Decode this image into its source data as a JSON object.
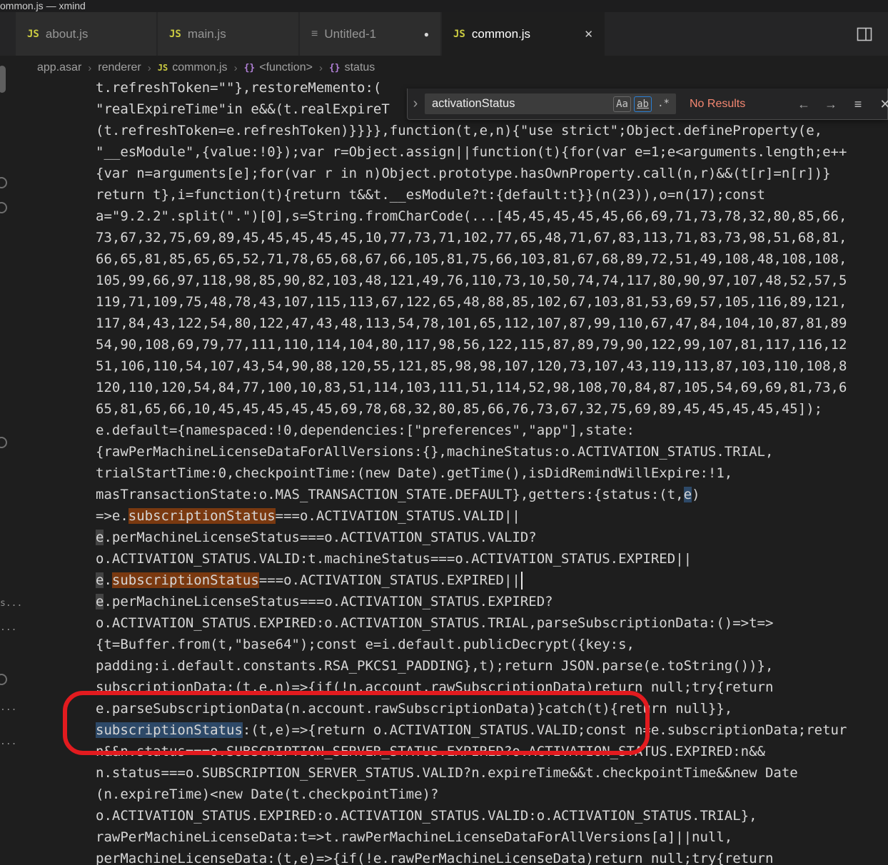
{
  "window": {
    "title": "ommon.js — xmind"
  },
  "icons": {
    "js": "JS",
    "file": "≡",
    "dirty": "●",
    "close": "✕",
    "chevron": "›",
    "symbol": "{}",
    "prev": "←",
    "next": "→",
    "selection": "≡"
  },
  "tabs": [
    {
      "label": "about.js",
      "icon": "js",
      "active": false,
      "dirty": false,
      "closable": false
    },
    {
      "label": "main.js",
      "icon": "js",
      "active": false,
      "dirty": false,
      "closable": false
    },
    {
      "label": "Untitled-1",
      "icon": "file",
      "active": false,
      "dirty": true,
      "closable": false
    },
    {
      "label": "common.js",
      "icon": "js",
      "active": true,
      "dirty": false,
      "closable": true
    }
  ],
  "breadcrumbs": [
    {
      "label": "app.asar"
    },
    {
      "label": "renderer"
    },
    {
      "label": "common.js",
      "icon": "js"
    },
    {
      "label": "<function>",
      "icon": "symbol"
    },
    {
      "label": "status",
      "icon": "symbol"
    }
  ],
  "find": {
    "query": "activationStatus",
    "match_case_label": "Aa",
    "whole_word_label": "ab",
    "regex_label": ".*",
    "results_text": "No Results"
  },
  "colors": {
    "accent_blue": "#2a7fd4",
    "match_orange": "#ea5c00",
    "error_red": "#f48771",
    "annotation_red": "#e21b1f",
    "js_icon_yellow": "#cbcb41",
    "symbol_purple": "#b180d7"
  },
  "editor": {
    "gutter_fragments": [
      "s...",
      "...",
      "...",
      "..."
    ],
    "lines": [
      {
        "segs": [
          {
            "t": "t.refreshToken=\"\"},restoreMemento:("
          }
        ]
      },
      {
        "segs": [
          {
            "t": "\"realExpireTime\"in e&&(t.realExpireT"
          }
        ]
      },
      {
        "segs": [
          {
            "t": "(t.refreshToken=e.refreshToken)}}}},function(t,e,n){\"use strict\";Object.defineProperty(e,"
          }
        ]
      },
      {
        "segs": [
          {
            "t": "\"__esModule\",{value:!0});var r=Object.assign||function(t){for(var e=1;e<arguments.length;e++"
          }
        ]
      },
      {
        "segs": [
          {
            "t": "{var n=arguments[e];for(var r in n)Object.prototype.hasOwnProperty.call(n,r)&&(t[r]=n[r])}"
          }
        ]
      },
      {
        "segs": [
          {
            "t": "return t},i=function(t){return t&&t.__esModule?t:{default:t}}(n(23)),o=n(17);const"
          }
        ]
      },
      {
        "segs": [
          {
            "t": "a=\"9.2.2\".split(\".\")[0],s=String.fromCharCode(...[45,45,45,45,45,66,69,71,73,78,32,80,85,66,"
          }
        ]
      },
      {
        "segs": [
          {
            "t": "73,67,32,75,69,89,45,45,45,45,45,10,77,73,71,102,77,65,48,71,67,83,113,71,83,73,98,51,68,81,"
          }
        ]
      },
      {
        "segs": [
          {
            "t": "66,65,81,85,65,65,52,71,78,65,68,67,66,105,81,75,66,103,81,67,68,89,72,51,49,108,48,108,108,"
          }
        ]
      },
      {
        "segs": [
          {
            "t": "105,99,66,97,118,98,85,90,82,103,48,121,49,76,110,73,10,50,74,74,117,80,90,97,107,48,52,57,5"
          }
        ]
      },
      {
        "segs": [
          {
            "t": "119,71,109,75,48,78,43,107,115,113,67,122,65,48,88,85,102,67,103,81,53,69,57,105,116,89,121,"
          }
        ]
      },
      {
        "segs": [
          {
            "t": "117,84,43,122,54,80,122,47,43,48,113,54,78,101,65,112,107,87,99,110,67,47,84,104,10,87,81,89"
          }
        ]
      },
      {
        "segs": [
          {
            "t": "54,90,108,69,79,77,111,110,114,104,80,117,98,56,122,115,87,89,79,90,122,99,107,81,117,116,12"
          }
        ]
      },
      {
        "segs": [
          {
            "t": "51,106,110,54,107,43,54,90,88,120,55,121,85,98,98,107,120,73,107,43,119,113,87,103,110,108,8"
          }
        ]
      },
      {
        "segs": [
          {
            "t": "120,110,120,54,84,77,100,10,83,51,114,103,111,51,114,52,98,108,70,84,87,105,54,69,69,81,73,6"
          }
        ]
      },
      {
        "segs": [
          {
            "t": "65,81,65,66,10,45,45,45,45,45,69,78,68,32,80,85,66,76,73,67,32,75,69,89,45,45,45,45,45]);"
          }
        ]
      },
      {
        "segs": [
          {
            "t": "e.default={namespaced:!0,dependencies:[\"preferences\",\"app\"],state:"
          }
        ]
      },
      {
        "segs": [
          {
            "t": "{rawPerMachineLicenseDataForAllVersions:{},machineStatus:o.ACTIVATION_STATUS.TRIAL,"
          }
        ]
      },
      {
        "segs": [
          {
            "t": "trialStartTime:0,checkpointTime:(new Date).getTime(),isDidRemindWillExpire:!1,"
          }
        ]
      },
      {
        "segs": [
          {
            "t": "masTransactionState:o.MAS_TRANSACTION_STATE.DEFAULT},getters:{status:(t,"
          },
          {
            "t": "e",
            "h": "s"
          },
          {
            "t": ")"
          }
        ]
      },
      {
        "segs": [
          {
            "t": "=>e."
          },
          {
            "t": "subscriptionStatus",
            "h": "m"
          },
          {
            "t": "===o.ACTIVATION_STATUS.VALID||"
          }
        ]
      },
      {
        "segs": [
          {
            "t": "e",
            "h": "w"
          },
          {
            "t": ".perMachineLicenseStatus===o.ACTIVATION_STATUS.VALID?"
          }
        ]
      },
      {
        "segs": [
          {
            "t": "o.ACTIVATION_STATUS.VALID:t.machineStatus===o.ACTIVATION_STATUS.EXPIRED||"
          }
        ]
      },
      {
        "segs": [
          {
            "t": "e",
            "h": "w"
          },
          {
            "t": "."
          },
          {
            "t": "subscriptionStatus",
            "h": "m"
          },
          {
            "t": "===o.ACTIVATION_STATUS.EXPIRED||"
          },
          {
            "c": true
          }
        ]
      },
      {
        "segs": [
          {
            "t": "e",
            "h": "w"
          },
          {
            "t": ".perMachineLicenseStatus===o.ACTIVATION_STATUS.EXPIRED?"
          }
        ]
      },
      {
        "segs": [
          {
            "t": "o.ACTIVATION_STATUS.EXPIRED:o.ACTIVATION_STATUS.TRIAL,parseSubscriptionData:()=>t=>"
          }
        ]
      },
      {
        "segs": [
          {
            "t": "{t=Buffer.from(t,\"base64\");const e=i.default.publicDecrypt({key:s,"
          }
        ]
      },
      {
        "segs": [
          {
            "t": "padding:i.default.constants.RSA_PKCS1_PADDING},t);return JSON.parse(e.toString())},"
          }
        ]
      },
      {
        "segs": [
          {
            "t": "subscriptionData:(t,e,n)=>{if(!n.account.rawSubscriptionData)return null;try{return"
          }
        ]
      },
      {
        "segs": [
          {
            "t": "e.parseSubscriptionData(n.account.rawSubscriptionData)}catch(t){return null}},"
          }
        ]
      },
      {
        "segs": [
          {
            "t": "subscriptionStatus",
            "h": "s"
          },
          {
            "t": ":(t,e)=>{return o.ACTIVATION_STATUS.VALID;const n=e.subscriptionData;retur"
          }
        ]
      },
      {
        "segs": [
          {
            "t": "n&&n.status===o.SUBSCRIPTION_SERVER_STATUS.EXPIRED?o.ACTIVATION_STATUS.EXPIRED:n&&"
          }
        ]
      },
      {
        "segs": [
          {
            "t": "n.status===o.SUBSCRIPTION_SERVER_STATUS.VALID?n.expireTime&&t.checkpointTime&&new Date"
          }
        ]
      },
      {
        "segs": [
          {
            "t": "(n.expireTime)<new Date(t.checkpointTime)?"
          }
        ]
      },
      {
        "segs": [
          {
            "t": "o.ACTIVATION_STATUS.EXPIRED:o.ACTIVATION_STATUS.VALID:o.ACTIVATION_STATUS.TRIAL},"
          }
        ]
      },
      {
        "segs": [
          {
            "t": "rawPerMachineLicenseData:t=>t.rawPerMachineLicenseDataForAllVersions[a]||null,"
          }
        ]
      },
      {
        "segs": [
          {
            "t": "perMachineLicenseData:(t,e)=>{if(!e.rawPerMachineLicenseData)return null;try{return"
          }
        ]
      }
    ]
  }
}
